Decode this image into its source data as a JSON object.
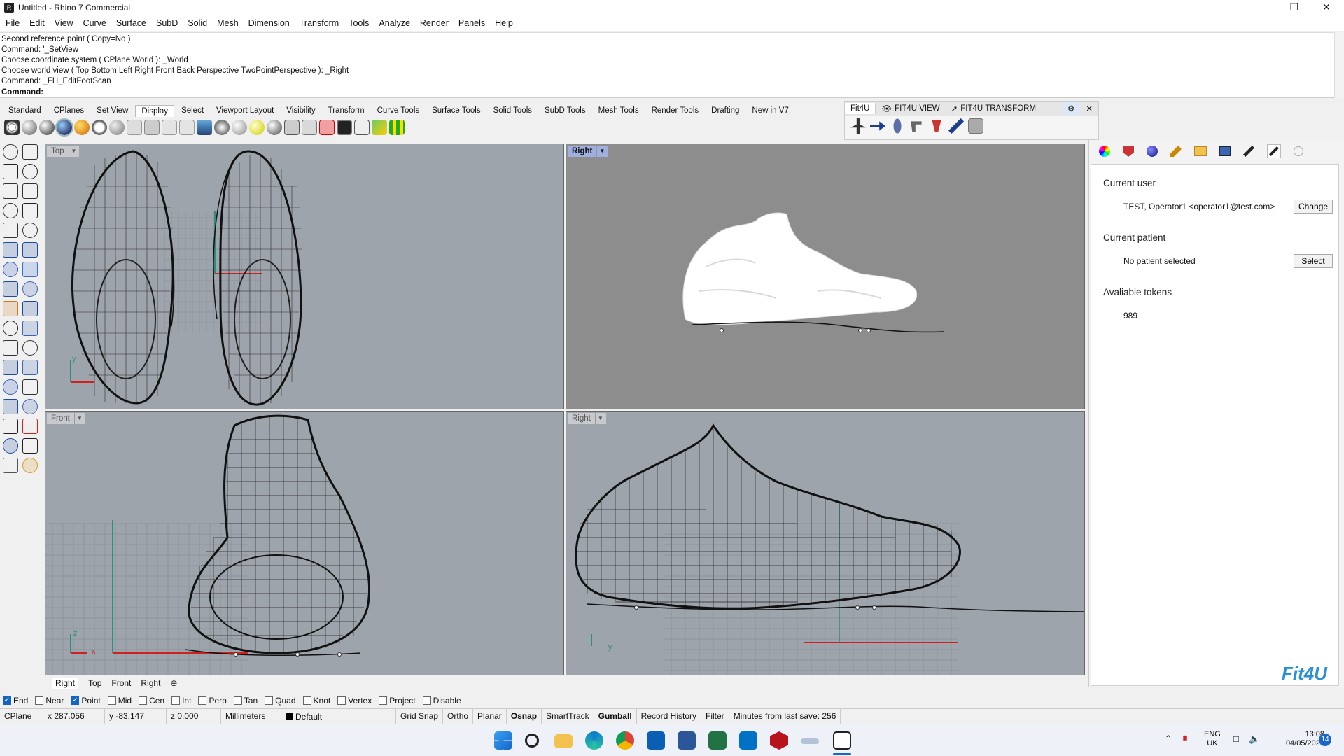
{
  "window": {
    "title": "Untitled - Rhino 7 Commercial"
  },
  "menu": [
    "File",
    "Edit",
    "View",
    "Curve",
    "Surface",
    "SubD",
    "Solid",
    "Mesh",
    "Dimension",
    "Transform",
    "Tools",
    "Analyze",
    "Render",
    "Panels",
    "Help"
  ],
  "command_history": [
    "Second reference point ( Copy=No )",
    "Command: '_SetView",
    "Choose coordinate system ( CPlane  World ): _World",
    "Choose world view ( Top  Bottom  Left  Right  Front  Back  Perspective  TwoPointPerspective ): _Right",
    "Command: _FH_EditFootScan"
  ],
  "command_prompt": "Command:",
  "toolbar_tabs": [
    "Standard",
    "CPlanes",
    "Set View",
    "Display",
    "Select",
    "Viewport Layout",
    "Visibility",
    "Transform",
    "Curve Tools",
    "Surface Tools",
    "Solid Tools",
    "SubD Tools",
    "Mesh Tools",
    "Render Tools",
    "Drafting",
    "New in V7"
  ],
  "active_toolbar_tab": "Display",
  "fit4u_tabs": [
    "Fit4U",
    "FIT4U VIEW",
    "FIT4U TRANSFORM"
  ],
  "viewports": {
    "top_left": "Top",
    "top_right": "Right",
    "bottom_left": "Front",
    "bottom_right": "Right"
  },
  "view_tabs": [
    "Right",
    "Top",
    "Front",
    "Right"
  ],
  "panel": {
    "current_user_heading": "Current user",
    "current_user_value": "TEST, Operator1 <operator1@test.com>",
    "change_button": "Change",
    "current_patient_heading": "Current patient",
    "current_patient_value": "No patient selected",
    "select_button": "Select",
    "tokens_heading": "Avaliable tokens",
    "tokens_value": "989",
    "logo": "Fit4U"
  },
  "osnap": [
    {
      "label": "End",
      "checked": true
    },
    {
      "label": "Near",
      "checked": false
    },
    {
      "label": "Point",
      "checked": true
    },
    {
      "label": "Mid",
      "checked": false
    },
    {
      "label": "Cen",
      "checked": false
    },
    {
      "label": "Int",
      "checked": false
    },
    {
      "label": "Perp",
      "checked": false
    },
    {
      "label": "Tan",
      "checked": false
    },
    {
      "label": "Quad",
      "checked": false
    },
    {
      "label": "Knot",
      "checked": false
    },
    {
      "label": "Vertex",
      "checked": false
    },
    {
      "label": "Project",
      "checked": false
    },
    {
      "label": "Disable",
      "checked": false
    }
  ],
  "status": {
    "cplane": "CPlane",
    "x": "x 287.056",
    "y": "y -83.147",
    "z": "z 0.000",
    "units": "Millimeters",
    "layer": "Default",
    "toggles": [
      "Grid Snap",
      "Ortho",
      "Planar",
      "Osnap",
      "SmartTrack",
      "Gumball",
      "Record History",
      "Filter"
    ],
    "save_info": "Minutes from last save: 256"
  },
  "taskbar": {
    "lang1": "ENG",
    "lang2": "UK",
    "time": "13:08",
    "date": "04/05/2022",
    "badge": "14"
  },
  "colors": {
    "accent": "#1464c8",
    "viewport_bg": "#9ea4ab",
    "shaded_bg": "#8d8d8d",
    "logo": "#2c8fd6"
  }
}
